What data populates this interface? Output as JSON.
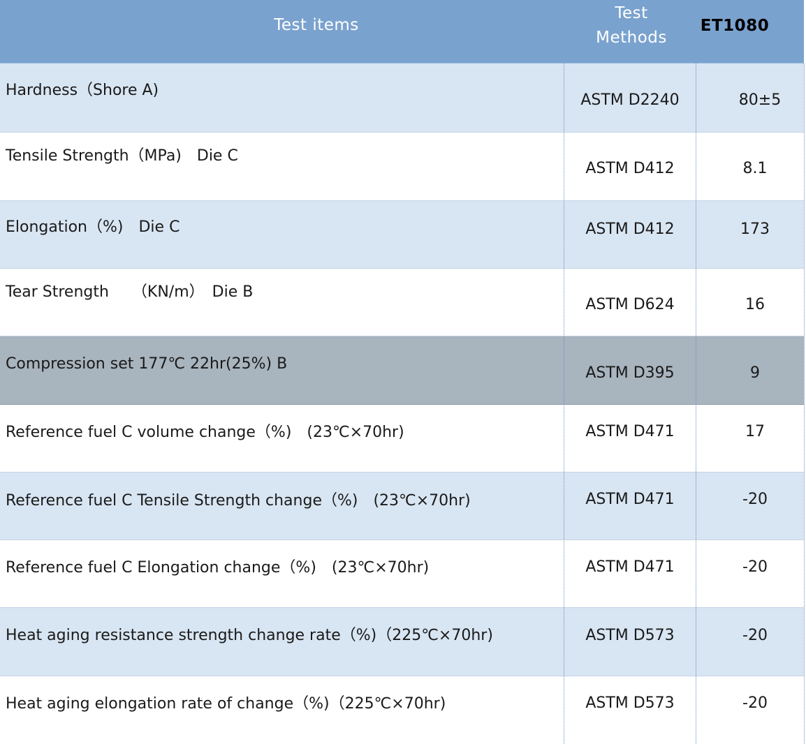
{
  "header": {
    "test_items": "Test items",
    "test_methods": "Test Methods",
    "product": "ET1080"
  },
  "rows": [
    {
      "item": "Hardness（Shore A)",
      "method": "ASTM D2240",
      "value": "80±5"
    },
    {
      "item": "Tensile Strength（MPa)　Die C",
      "method": "ASTM D412",
      "value": "8.1"
    },
    {
      "item": "Elongation（%)　Die C",
      "method": "ASTM D412",
      "value": "173"
    },
    {
      "item": "Tear Strength　　（KN/m）　Die B",
      "method": "ASTM D624",
      "value": "16"
    },
    {
      "item": "Compression set 177℃ 22hr(25%) B",
      "method": "ASTM D395",
      "value": "9"
    },
    {
      "item": "Reference fuel C volume change（%)　(23℃×70hr)",
      "method": "ASTM D471",
      "value": "17"
    },
    {
      "item": "Reference fuel C Tensile Strength change（%)　(23℃×70hr)",
      "method": "ASTM D471",
      "value": "-20"
    },
    {
      "item": "Reference fuel C Elongation change（%)　(23℃×70hr)",
      "method": "ASTM D471",
      "value": "-20"
    },
    {
      "item": "Heat aging resistance strength change rate（%)（225℃×70hr)",
      "method": "ASTM D573",
      "value": "-20"
    },
    {
      "item": "Heat aging elongation rate of change（%)（225℃×70hr)",
      "method": "ASTM D573",
      "value": "-20"
    }
  ],
  "colors": {
    "header_bg": "#7aa2ce",
    "row_blue": "#d8e5f2",
    "row_gray": "#a8b4be",
    "row_white": "#ffffff"
  }
}
